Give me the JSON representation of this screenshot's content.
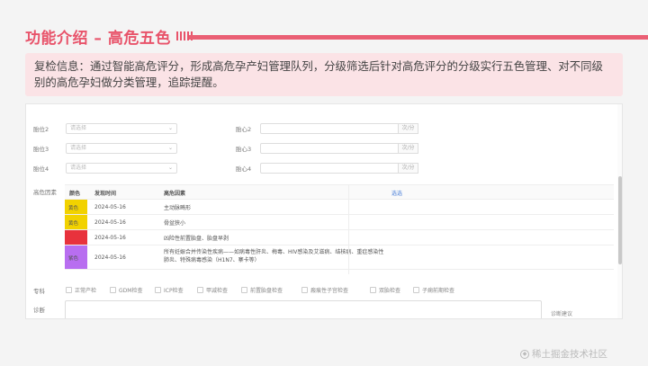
{
  "header": {
    "title": "功能介绍 – 高危五色"
  },
  "notice": {
    "text": "复检信息：通过智能高危评分，形成高危孕产妇管理队列，分级筛选后针对高危评分的分级实行五色管理、对不同级别的高危孕妇做分类管理，追踪提醒。"
  },
  "form": {
    "rows": [
      {
        "label": "胎位2",
        "select_placeholder": "请选择",
        "hr_label": "胎心2",
        "unit": "次/分"
      },
      {
        "label": "胎位3",
        "select_placeholder": "请选择",
        "hr_label": "胎心3",
        "unit": "次/分"
      },
      {
        "label": "胎位4",
        "select_placeholder": "请选择",
        "hr_label": "胎心4",
        "unit": "次/分"
      }
    ]
  },
  "risk": {
    "label": "高危因素",
    "headers": {
      "color": "颜色",
      "date": "发现时间",
      "factor": "高危因素",
      "action": "选选"
    },
    "rows": [
      {
        "color_name": "黄色",
        "color": "#f2d200",
        "date": "2024-05-16",
        "factor": "主动脉畸形"
      },
      {
        "color_name": "黄色",
        "color": "#f2d200",
        "date": "2024-05-16",
        "factor": "骨盆狭小"
      },
      {
        "color_name": "",
        "color": "#e8323c",
        "date": "2024-05-16",
        "factor": "凶险性前置胎盘、胎盘早剥"
      },
      {
        "color_name": "紫色",
        "color": "#b86ef0",
        "date": "2024-05-16",
        "factor": "所有妊娠合并传染性疾病——如病毒性肝炎、梅毒、HIV感染及艾滋病、结核病、重症感染性肺炎、特殊病毒感染（H1N7、寨卡等）"
      }
    ]
  },
  "checks": {
    "label": "专科",
    "items": [
      "正常产检",
      "GDM检查",
      "ICP检查",
      "甲减检查",
      "前置胎盘检查",
      "瘢痕性子宫检查",
      "双胎检查",
      "子痫前期检查"
    ]
  },
  "diagnosis": {
    "label": "诊断",
    "note": "诊断建议"
  },
  "watermark": {
    "text": "稀土掘金技术社区",
    "icon": "juejin-logo-icon"
  }
}
